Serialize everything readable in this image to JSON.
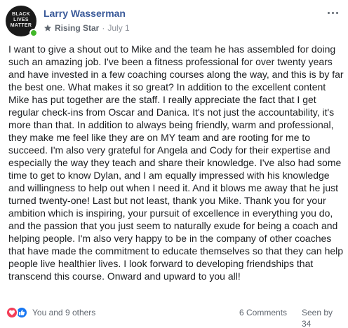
{
  "post": {
    "author": "Larry Wasserman",
    "avatar_text": "BLACK LIVES MATTER",
    "badge": "Rising Star",
    "separator": "·",
    "date": "July 1",
    "body": "I want to give a shout out to Mike and the team he has assembled for doing such an amazing job. I've been a fitness professional for over twenty years and have invested in a few coaching courses along the way, and this is by far the best one. What makes it so great? In addition to the excellent content Mike has put together are the staff. I really appreciate the fact that I get regular check-ins from Oscar and Danica. It's not just the accountability, it's more than that. In addition to always being friendly, warm and professional, they make me feel like they are on MY team and are rooting for me to succeed. I'm also very grateful for Angela and Cody for their expertise and especially the way they teach and share their knowledge. I've also had some time to get to know Dylan, and I am equally impressed with his knowledge and willingness to help out when I need it. And it blows me away that he just turned twenty-one! Last but not least, thank you Mike. Thank you for your ambition which is inspiring, your pursuit of excellence in everything you do, and the passion that you just seem to naturally exude for being a coach and helping people. I'm also very happy to be in the company of other coaches that have made the commitment to educate themselves so that they can help people live healthier lives. I look forward to developing friendships that transcend this course. Onward and upward to you all!"
  },
  "reactions": {
    "summary": "You and 9 others",
    "icons": [
      "love-icon",
      "like-icon"
    ]
  },
  "stats": {
    "comments": "6 Comments",
    "seen": "Seen by 34"
  },
  "colors": {
    "author": "#385898",
    "presence": "#42b72a",
    "love": "#f33e58",
    "like": "#1877f2",
    "muted": "#606770"
  }
}
